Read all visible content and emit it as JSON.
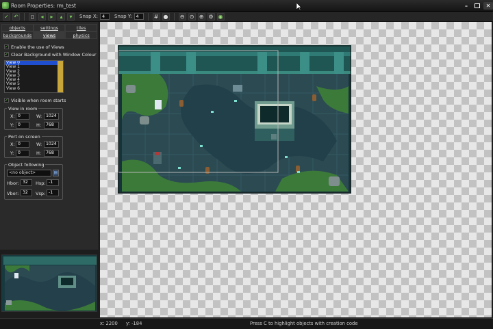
{
  "window": {
    "title": "Room Properties: rm_test"
  },
  "toolbar": {
    "snap_x_label": "Snap X:",
    "snap_x": "4",
    "snap_y_label": "Snap Y:",
    "snap_y": "4"
  },
  "tabs": {
    "row1": [
      "objects",
      "settings",
      "tiles"
    ],
    "row2": [
      "backgrounds",
      "views",
      "physics"
    ],
    "active": "views"
  },
  "views_panel": {
    "enable_views": "Enable the use of Views",
    "clear_background": "Clear Background with Window Colour",
    "views": [
      "View 0",
      "View 1",
      "View 2",
      "View 3",
      "View 4",
      "View 5",
      "View 6"
    ],
    "selected_view": "View 0",
    "visible_when_room_starts": "Visible when room starts",
    "view_in_room": {
      "title": "View in room",
      "x_label": "X:",
      "x": "0",
      "w_label": "W:",
      "w": "1024",
      "y_label": "Y:",
      "y": "0",
      "h_label": "H:",
      "h": "768"
    },
    "port_on_screen": {
      "title": "Port on screen",
      "x_label": "X:",
      "x": "0",
      "w_label": "W:",
      "w": "1024",
      "y_label": "Y:",
      "y": "0",
      "h_label": "H:",
      "h": "768"
    },
    "object_following": {
      "title": "Object following",
      "object": "<no object>",
      "hbor_label": "Hbor:",
      "hbor": "32",
      "hsp_label": "Hsp:",
      "hsp": "-1",
      "vbor_label": "Vbor:",
      "vbor": "32",
      "vsp_label": "Vsp:",
      "vsp": "-1"
    }
  },
  "status": {
    "x": "x: 2200",
    "y": "y: -184",
    "hint": "Press C to highlight objects with creation code"
  },
  "colors": {
    "selection": "#1f4fcf",
    "check": "#7bd25b",
    "room_floor": "#2b4a52"
  }
}
